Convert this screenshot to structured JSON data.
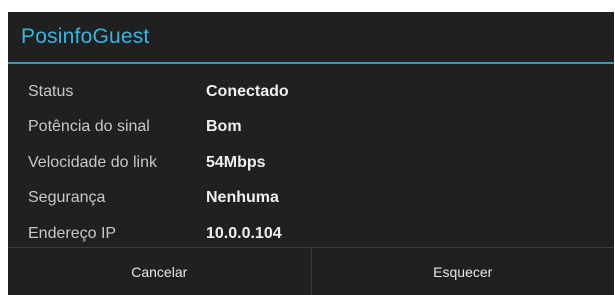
{
  "dialog": {
    "title": "PosinfoGuest",
    "details": [
      {
        "label": "Status",
        "value": "Conectado"
      },
      {
        "label": "Potência do sinal",
        "value": "Bom"
      },
      {
        "label": "Velocidade do link",
        "value": "54Mbps"
      },
      {
        "label": "Segurança",
        "value": "Nenhuma"
      },
      {
        "label": "Endereço IP",
        "value": "10.0.0.104"
      }
    ],
    "buttons": {
      "cancel_label": "Cancelar",
      "forget_label": "Esquecer"
    }
  },
  "colors": {
    "dialog_background": "#202020",
    "title_accent": "#35b6e0",
    "divider_accent": "#2f9fbf"
  }
}
